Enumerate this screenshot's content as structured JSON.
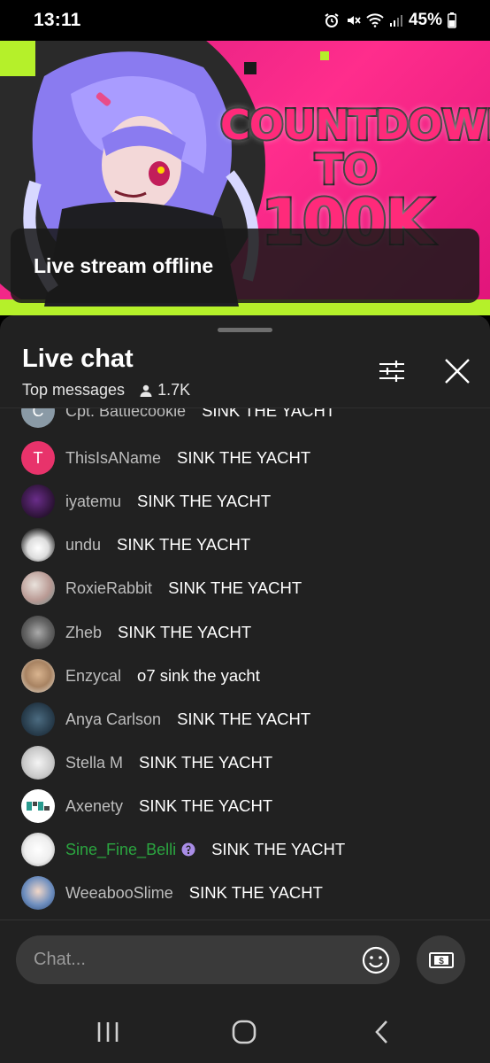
{
  "status_bar": {
    "time": "13:11",
    "battery": "45%"
  },
  "video": {
    "thumbnail_title_line1": "COUNTDOWN",
    "thumbnail_title_line2": "TO",
    "thumbnail_title_line3": "100K",
    "offline_text": "Live stream offline"
  },
  "chat": {
    "title": "Live chat",
    "mode": "Top messages",
    "viewers": "1.7K",
    "input_placeholder": "Chat...",
    "messages": [
      {
        "author": "Cpt. Battlecookie",
        "text": "SINK THE YACHT",
        "avatar_letter": "C",
        "avatar_color": "#8a9aa6"
      },
      {
        "author": "ThisIsAName",
        "text": "SINK THE YACHT",
        "avatar_letter": "T",
        "avatar_color": "#e8336b"
      },
      {
        "author": "iyatemu",
        "text": "SINK THE YACHT",
        "avatar_letter": "",
        "avatar_color": "#3a1f4a"
      },
      {
        "author": "undu",
        "text": "SINK THE YACHT",
        "avatar_letter": "",
        "avatar_color": "#e8e8e8"
      },
      {
        "author": "RoxieRabbit",
        "text": "SINK THE YACHT",
        "avatar_letter": "",
        "avatar_color": "#c9b7b0"
      },
      {
        "author": "Zheb",
        "text": "SINK THE YACHT",
        "avatar_letter": "",
        "avatar_color": "#6f6f6f"
      },
      {
        "author": "Enzycal",
        "text": "o7 sink the yacht",
        "avatar_letter": "",
        "avatar_color": "#c8a98a"
      },
      {
        "author": "Anya Carlson",
        "text": "SINK THE YACHT",
        "avatar_letter": "",
        "avatar_color": "#2e4a5e"
      },
      {
        "author": "Stella M",
        "text": "SINK THE YACHT",
        "avatar_letter": "",
        "avatar_color": "#d9d9d9"
      },
      {
        "author": "Axenety",
        "text": "SINK THE YACHT",
        "avatar_letter": "",
        "avatar_color": "#ffffff"
      },
      {
        "author": "Sine_Fine_Belli",
        "text": "SINK THE YACHT",
        "avatar_letter": "",
        "avatar_color": "#f2f2f2",
        "author_color": "#2ba640"
      },
      {
        "author": "WeeabooSlime",
        "text": "SINK THE YACHT",
        "avatar_letter": "",
        "avatar_color": "#3d5f8a"
      }
    ]
  },
  "icons": {
    "filter": "tune-icon",
    "close": "close-icon",
    "emoji": "emoji-icon",
    "super_chat": "dollar-bill-icon",
    "viewers": "person-icon",
    "moderator": "wrench-icon"
  },
  "colors": {
    "panel_bg": "#212121",
    "green_author": "#2ba640",
    "thumbnail_pink": "#ff2d8c"
  }
}
